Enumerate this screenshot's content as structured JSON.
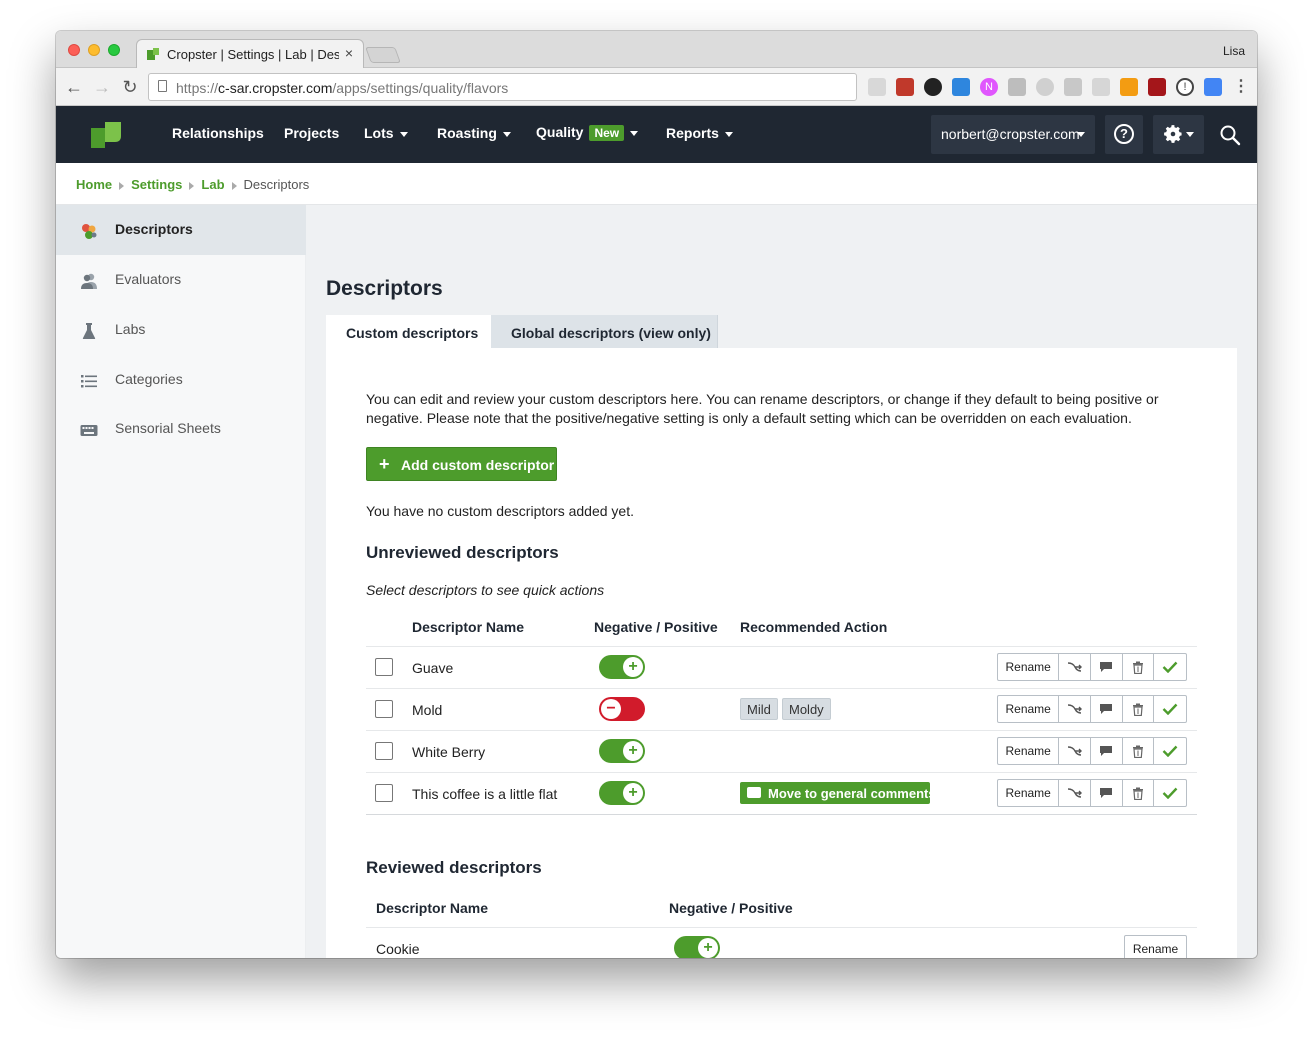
{
  "browser": {
    "tab_title": "Cropster | Settings | Lab | Descriptors",
    "tab_close": "×",
    "profile_name": "Lisa",
    "url_prefix": "https://",
    "url_host": "c-sar.cropster.com",
    "url_path": "/apps/settings/quality/flavors",
    "nav_icons": [
      "back-arrow-icon",
      "forward-arrow-icon",
      "reload-icon",
      "page-info-icon"
    ],
    "extension_icons": [
      "ext-1",
      "ext-2",
      "ext-3",
      "ext-4",
      "ext-5",
      "ext-6",
      "ext-7",
      "ext-8",
      "ext-9",
      "ext-10",
      "ext-11",
      "ext-12",
      "ext-13",
      "ext-14",
      "menu-dots-icon"
    ]
  },
  "appnav": {
    "items": [
      {
        "label": "Relationships"
      },
      {
        "label": "Projects"
      },
      {
        "label": "Lots"
      },
      {
        "label": "Roasting"
      },
      {
        "label": "Quality",
        "badge": "New"
      },
      {
        "label": "Reports"
      }
    ],
    "user_email": "norbert@cropster.com",
    "help_glyph": "?",
    "colors": {
      "bar": "#1f2732",
      "accent": "#4d9c2c",
      "button": "#2d3643"
    }
  },
  "breadcrumb": {
    "items": [
      "Home",
      "Settings",
      "Lab"
    ],
    "current": "Descriptors"
  },
  "sidebar": {
    "items": [
      {
        "label": "Descriptors",
        "icon": "descriptors-icon",
        "active": true
      },
      {
        "label": "Evaluators",
        "icon": "evaluators-icon"
      },
      {
        "label": "Labs",
        "icon": "flask-icon"
      },
      {
        "label": "Categories",
        "icon": "list-icon"
      },
      {
        "label": "Sensorial Sheets",
        "icon": "keyboard-icon"
      }
    ]
  },
  "main": {
    "title": "Descriptors",
    "tabs": [
      {
        "label": "Custom descriptors",
        "active": true
      },
      {
        "label": "Global descriptors (view only)"
      }
    ],
    "intro": "You can edit and review your custom descriptors here. You can rename descriptors, or change if they default to being positive or negative. Please note that the positive/negative setting is only a default setting which can be overridden on each evaluation.",
    "add_button": "Add custom descriptor",
    "no_custom": "You have no custom descriptors added yet.",
    "unreviewed": {
      "heading": "Unreviewed descriptors",
      "hint": "Select descriptors to see quick actions",
      "columns": [
        "Descriptor Name",
        "Negative / Positive",
        "Recommended Action"
      ],
      "rows": [
        {
          "name": "Guave",
          "positive": true,
          "recommended": []
        },
        {
          "name": "Mold",
          "positive": false,
          "recommended": [
            "Mild",
            "Moldy"
          ]
        },
        {
          "name": "White Berry",
          "positive": true,
          "recommended": []
        },
        {
          "name": "This coffee is a little flat",
          "positive": true,
          "move_button": "Move to general comments"
        }
      ],
      "row_actions": {
        "rename": "Rename",
        "icons": [
          "merge-icon",
          "comment-icon",
          "trash-icon",
          "check-icon"
        ]
      }
    },
    "reviewed": {
      "heading": "Reviewed descriptors",
      "columns": [
        "Descriptor Name",
        "Negative / Positive"
      ],
      "rows": [
        {
          "name": "Cookie",
          "positive": true
        }
      ],
      "rename": "Rename"
    },
    "toggle_glyphs": {
      "positive": "+",
      "negative": "−"
    }
  }
}
